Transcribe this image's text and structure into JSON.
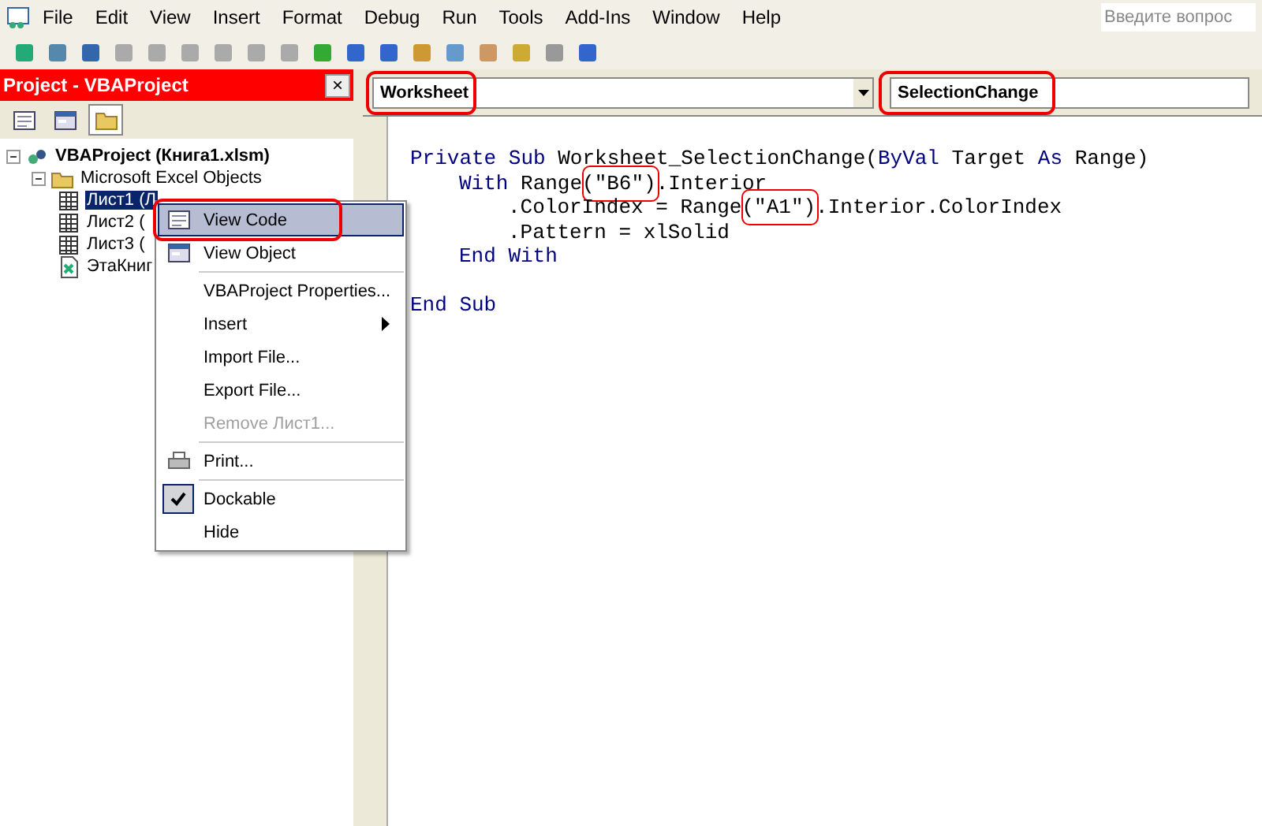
{
  "menu_bar": [
    "File",
    "Edit",
    "View",
    "Insert",
    "Format",
    "Debug",
    "Run",
    "Tools",
    "Add-Ins",
    "Window",
    "Help"
  ],
  "help_search": {
    "placeholder": "Введите вопрос"
  },
  "project_panel": {
    "title": "Project - VBAProject",
    "close": "×",
    "tree": [
      {
        "label": "VBAProject (Книга1.xlsm)",
        "kind": "project",
        "expanded": true,
        "children": [
          {
            "label": "Microsoft Excel Objects",
            "kind": "folder",
            "expanded": true,
            "children": [
              {
                "label": "Лист1 (Л",
                "kind": "sheet",
                "selected": true
              },
              {
                "label": "Лист2 (",
                "kind": "sheet",
                "selected": false
              },
              {
                "label": "Лист3 (",
                "kind": "sheet",
                "selected": false
              },
              {
                "label": "ЭтаКниг",
                "kind": "workbook",
                "selected": false
              }
            ]
          }
        ]
      }
    ]
  },
  "context_menu": [
    {
      "label": "View Code",
      "kind": "item",
      "selected": true,
      "circled": true
    },
    {
      "label": "View Object",
      "kind": "item",
      "selected": false
    },
    {
      "kind": "separator"
    },
    {
      "label": "VBAProject Properties...",
      "kind": "item",
      "selected": false
    },
    {
      "label": "Insert",
      "kind": "submenu",
      "selected": false
    },
    {
      "label": "Import File...",
      "kind": "item",
      "selected": false
    },
    {
      "label": "Export File...",
      "kind": "item",
      "selected": false
    },
    {
      "label": "Remove Лист1...",
      "kind": "item",
      "disabled": true,
      "selected": false
    },
    {
      "kind": "separator"
    },
    {
      "label": "Print...",
      "kind": "item",
      "selected": false
    },
    {
      "kind": "separator"
    },
    {
      "label": "Dockable",
      "kind": "item",
      "checked": true,
      "selected": false
    },
    {
      "label": "Hide",
      "kind": "item",
      "selected": false
    }
  ],
  "code_window": {
    "object_combo": {
      "value": "Worksheet",
      "circled": true
    },
    "procedure_combo": {
      "value": "SelectionChange",
      "circled": true
    },
    "lines": [
      {
        "tokens": [
          {
            "t": "Private Sub",
            "kind": "keyword"
          },
          {
            "t": " Worksheet_SelectionChange(",
            "kind": "plain"
          },
          {
            "t": "ByVal",
            "kind": "keyword"
          },
          {
            "t": " Target ",
            "kind": "plain"
          },
          {
            "t": "As",
            "kind": "keyword"
          },
          {
            "t": " Range)",
            "kind": "plain"
          }
        ],
        "children": [
          {
            "tokens": [
              {
                "t": "With",
                "kind": "keyword"
              },
              {
                "t": " Range",
                "kind": "plain"
              },
              {
                "t": "(\"B6\")",
                "kind": "plain",
                "circled": true
              },
              {
                "t": ".Interior",
                "kind": "plain"
              }
            ],
            "children": [
              {
                "tokens": [
                  {
                    "t": ".ColorIndex = Range",
                    "kind": "plain"
                  },
                  {
                    "t": "(\"A1\")",
                    "kind": "plain",
                    "circled": true
                  },
                  {
                    "t": ".Interior.ColorIndex",
                    "kind": "plain"
                  }
                ]
              },
              {
                "tokens": [
                  {
                    "t": ".Pattern = xlSolid",
                    "kind": "plain"
                  }
                ]
              }
            ]
          },
          {
            "tokens": [
              {
                "t": "End With",
                "kind": "keyword"
              }
            ]
          }
        ]
      },
      {
        "tokens": [
          {
            "t": "End Sub",
            "kind": "keyword"
          }
        ],
        "spaced": true
      }
    ]
  }
}
